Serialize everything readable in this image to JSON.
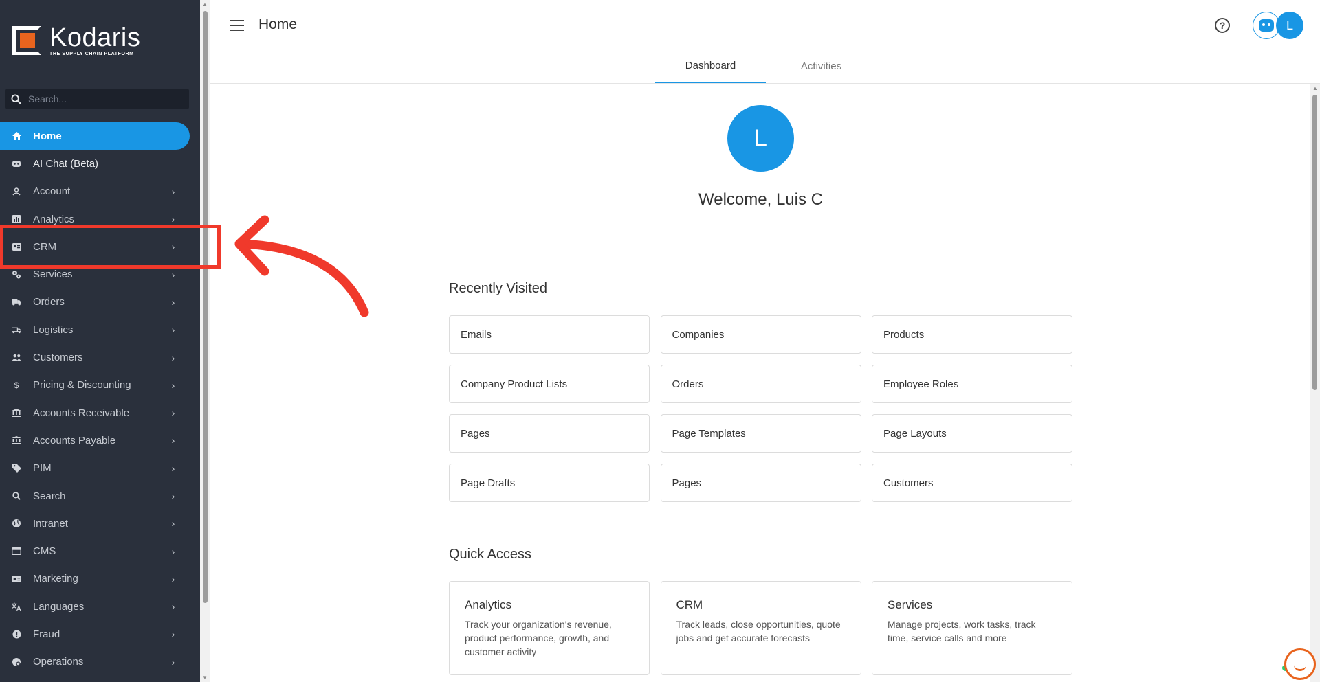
{
  "brand": {
    "name": "Kodaris",
    "tagline": "THE SUPPLY CHAIN PLATFORM"
  },
  "search": {
    "placeholder": "Search..."
  },
  "sidebar": {
    "items": [
      {
        "label": "Home",
        "icon": "home-icon",
        "active": true
      },
      {
        "label": "AI Chat (Beta)",
        "icon": "robot-icon"
      },
      {
        "label": "Account",
        "icon": "user-icon"
      },
      {
        "label": "Analytics",
        "icon": "chart-icon"
      },
      {
        "label": "CRM",
        "icon": "contact-card-icon"
      },
      {
        "label": "Services",
        "icon": "gears-icon"
      },
      {
        "label": "Orders",
        "icon": "truck-icon"
      },
      {
        "label": "Logistics",
        "icon": "delivery-icon"
      },
      {
        "label": "Customers",
        "icon": "people-icon"
      },
      {
        "label": "Pricing & Discounting",
        "icon": "dollar-icon"
      },
      {
        "label": "Accounts Receivable",
        "icon": "bank-icon"
      },
      {
        "label": "Accounts Payable",
        "icon": "bank-icon"
      },
      {
        "label": "PIM",
        "icon": "tag-icon"
      },
      {
        "label": "Search",
        "icon": "search-icon"
      },
      {
        "label": "Intranet",
        "icon": "globe-icon"
      },
      {
        "label": "CMS",
        "icon": "browser-icon"
      },
      {
        "label": "Marketing",
        "icon": "megaphone-icon"
      },
      {
        "label": "Languages",
        "icon": "translate-icon"
      },
      {
        "label": "Fraud",
        "icon": "alert-icon"
      },
      {
        "label": "Operations",
        "icon": "settings-icon"
      }
    ]
  },
  "header": {
    "title": "Home"
  },
  "tabs": [
    {
      "label": "Dashboard",
      "active": true
    },
    {
      "label": "Activities",
      "active": false
    }
  ],
  "user": {
    "initial": "L",
    "welcome": "Welcome, Luis C"
  },
  "recently_visited": {
    "title": "Recently Visited",
    "items": [
      "Emails",
      "Companies",
      "Products",
      "Company Product Lists",
      "Orders",
      "Employee Roles",
      "Pages",
      "Page Templates",
      "Page Layouts",
      "Page Drafts",
      "Pages",
      "Customers"
    ]
  },
  "quick_access": {
    "title": "Quick Access",
    "items": [
      {
        "title": "Analytics",
        "desc": "Track your organization's revenue, product performance, growth, and customer activity"
      },
      {
        "title": "CRM",
        "desc": "Track leads, close opportunities, quote jobs and get accurate forecasts"
      },
      {
        "title": "Services",
        "desc": "Manage projects, work tasks, track time, service calls and more"
      }
    ]
  },
  "colors": {
    "sidebar_bg": "#2a303c",
    "accent": "#1996e4",
    "brand_orange": "#e8641e",
    "annotation_red": "#f0392b"
  }
}
